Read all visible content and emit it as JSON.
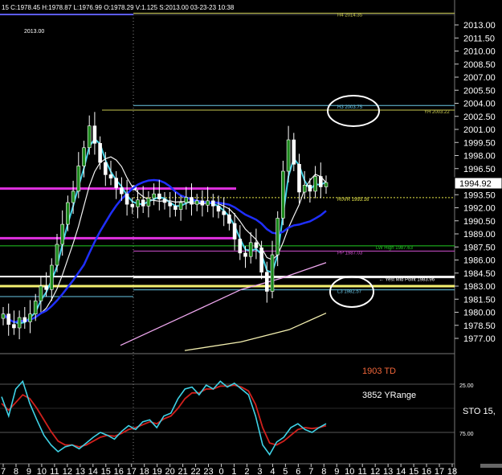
{
  "header": {
    "ohlc": "15  C:1978.45  H:1978.87  L:1976.99  O:1978.29  V:1.125  S:2013.00  03-23-23  10:38",
    "symbol_value": "2013.00"
  },
  "status": {
    "td_text": "1903 TD",
    "yrange_text": "3852 YRange",
    "sto_label": "STO  15,",
    "last_price": "1994.92"
  },
  "colors": {
    "background": "#000000",
    "candle": "#ffffff",
    "ma_fast": "#3fd2e6",
    "ma_mid": "#f2f2f2",
    "ma_slow": "#1f2fff",
    "ma_pink": "#f0a8f0",
    "ma_yellow": "#f4f0b0",
    "stoch_k": "#3fd2e6",
    "stoch_d": "#d0201c",
    "td_text": "#f0663a"
  },
  "chart_data": {
    "type": "line",
    "price_axis": {
      "ticks": [
        "2013.00",
        "2011.50",
        "2010.00",
        "2008.50",
        "2007.00",
        "2005.50",
        "2004.00",
        "2002.50",
        "2001.00",
        "1999.50",
        "1998.00",
        "1996.50",
        "1993.50",
        "1992.00",
        "1990.50",
        "1989.00",
        "1987.50",
        "1986.00",
        "1984.50",
        "1983.00",
        "1981.50",
        "1980.00",
        "1978.50",
        "1977.00"
      ],
      "ylim": [
        1975.5,
        2014.5
      ]
    },
    "time_axis": {
      "ticks": [
        "7",
        "8",
        "9",
        "10",
        "11",
        "12",
        "13",
        "14",
        "15",
        "16",
        "17",
        "18",
        "19",
        "20",
        "21",
        "22",
        "23",
        "0",
        "1",
        "2",
        "3",
        "4",
        "5",
        "6",
        "7",
        "8",
        "9",
        "10",
        "11",
        "12",
        "13",
        "14",
        "15",
        "16",
        "17",
        "18"
      ]
    },
    "levels": [
      {
        "label": "H4 2014.35",
        "value": 2014.35,
        "color": "#c8c850"
      },
      {
        "label": "H3 2003.75",
        "value": 2003.75,
        "color": "#6ac7e6"
      },
      {
        "label": "YH 2003.22",
        "value": 2003.22,
        "color": "#c8c850"
      },
      {
        "label": "R0VR 1993.16",
        "value": 1993.16,
        "color": "#e8e84a"
      },
      {
        "label": "LW High 1987.63",
        "value": 1987.63,
        "color": "#22cc22"
      },
      {
        "label": "PP 1987.03",
        "value": 1987.03,
        "color": "#d050d0"
      },
      {
        "label": "Yest Mid Point 1983.96",
        "value": 1983.96,
        "color": "#ffffff"
      },
      {
        "label": "L3 1982.57",
        "value": 1982.57,
        "color": "#6ac7e6"
      }
    ],
    "stochastic": {
      "levels": [
        "25.00",
        "75.00"
      ],
      "k": [
        38,
        58,
        30,
        22,
        45,
        62,
        78,
        88,
        95,
        90,
        88,
        92,
        86,
        80,
        75,
        78,
        82,
        74,
        68,
        72,
        64,
        62,
        70,
        58,
        55,
        40,
        30,
        28,
        36,
        26,
        30,
        22,
        28,
        24,
        30,
        36,
        58,
        88,
        98,
        85,
        80,
        70,
        66,
        72,
        75,
        70,
        66
      ],
      "d": [
        45,
        52,
        44,
        36,
        40,
        50,
        62,
        74,
        84,
        88,
        88,
        90,
        88,
        84,
        80,
        78,
        79,
        76,
        72,
        70,
        67,
        64,
        66,
        61,
        58,
        50,
        40,
        34,
        34,
        30,
        30,
        27,
        27,
        26,
        28,
        32,
        46,
        70,
        86,
        88,
        84,
        78,
        72,
        70,
        71,
        70,
        68
      ]
    }
  }
}
